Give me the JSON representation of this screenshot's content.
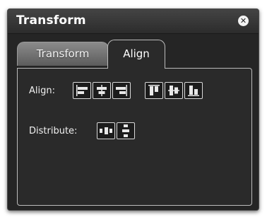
{
  "panel": {
    "title": "Transform"
  },
  "tabs": [
    {
      "label": "Transform",
      "selected": false
    },
    {
      "label": "Align",
      "selected": true
    }
  ],
  "align": {
    "label": "Align:",
    "buttons": [
      "align-left-icon",
      "align-center-horizontal-icon",
      "align-right-icon",
      "align-top-icon",
      "align-center-vertical-icon",
      "align-bottom-icon"
    ]
  },
  "distribute": {
    "label": "Distribute:",
    "buttons": [
      "distribute-horizontal-icon",
      "distribute-vertical-icon"
    ]
  }
}
